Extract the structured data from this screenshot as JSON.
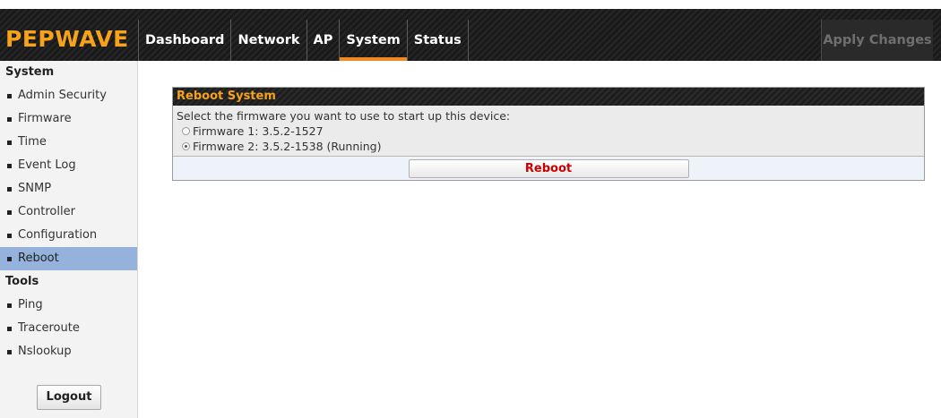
{
  "header": {
    "logo": "PEPWAVE",
    "nav": [
      {
        "label": "Dashboard"
      },
      {
        "label": "Network"
      },
      {
        "label": "AP"
      },
      {
        "label": "System",
        "active": true
      },
      {
        "label": "Status"
      }
    ],
    "apply_label": "Apply Changes"
  },
  "sidebar": {
    "sections": [
      {
        "title": "System",
        "items": [
          "Admin Security",
          "Firmware",
          "Time",
          "Event Log",
          "SNMP",
          "Controller",
          "Configuration",
          "Reboot"
        ]
      },
      {
        "title": "Tools",
        "items": [
          "Ping",
          "Traceroute",
          "Nslookup"
        ]
      }
    ],
    "active_item": "Reboot",
    "logout_label": "Logout"
  },
  "panel": {
    "title": "Reboot System",
    "instruction": "Select the firmware you want to use to start up this device:",
    "options": [
      {
        "label": "Firmware 1: 3.5.2-1527",
        "checked": false
      },
      {
        "label": "Firmware 2: 3.5.2-1538 (Running)",
        "checked": true
      }
    ],
    "reboot_label": "Reboot"
  },
  "colors": {
    "accent": "#f7a21b",
    "active_tab_underline": "#f08a24",
    "sidebar_active": "#94b2dc",
    "reboot_text": "#cc0000"
  }
}
